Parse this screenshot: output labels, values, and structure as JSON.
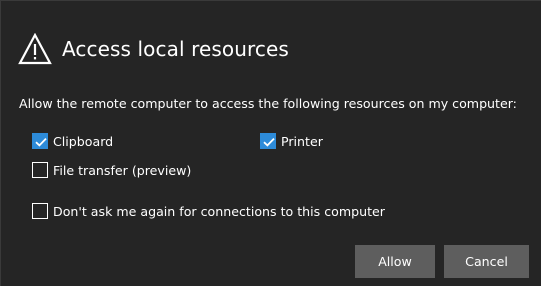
{
  "dialog": {
    "title": "Access local resources",
    "header_icon": "warning-triangle-icon",
    "description": "Allow the remote computer to access the following resources on my computer:",
    "options": {
      "clipboard": {
        "label": "Clipboard",
        "checked": true
      },
      "printer": {
        "label": "Printer",
        "checked": true
      },
      "file_transfer": {
        "label": "File transfer (preview)",
        "checked": false
      },
      "dont_ask": {
        "label": "Don't ask me again for connections to this computer",
        "checked": false
      }
    },
    "buttons": {
      "allow": "Allow",
      "cancel": "Cancel"
    }
  },
  "colors": {
    "background": "#252525",
    "checkbox_checked": "#2d8bd9",
    "button": "#5e5e5e",
    "text": "#ffffff"
  }
}
